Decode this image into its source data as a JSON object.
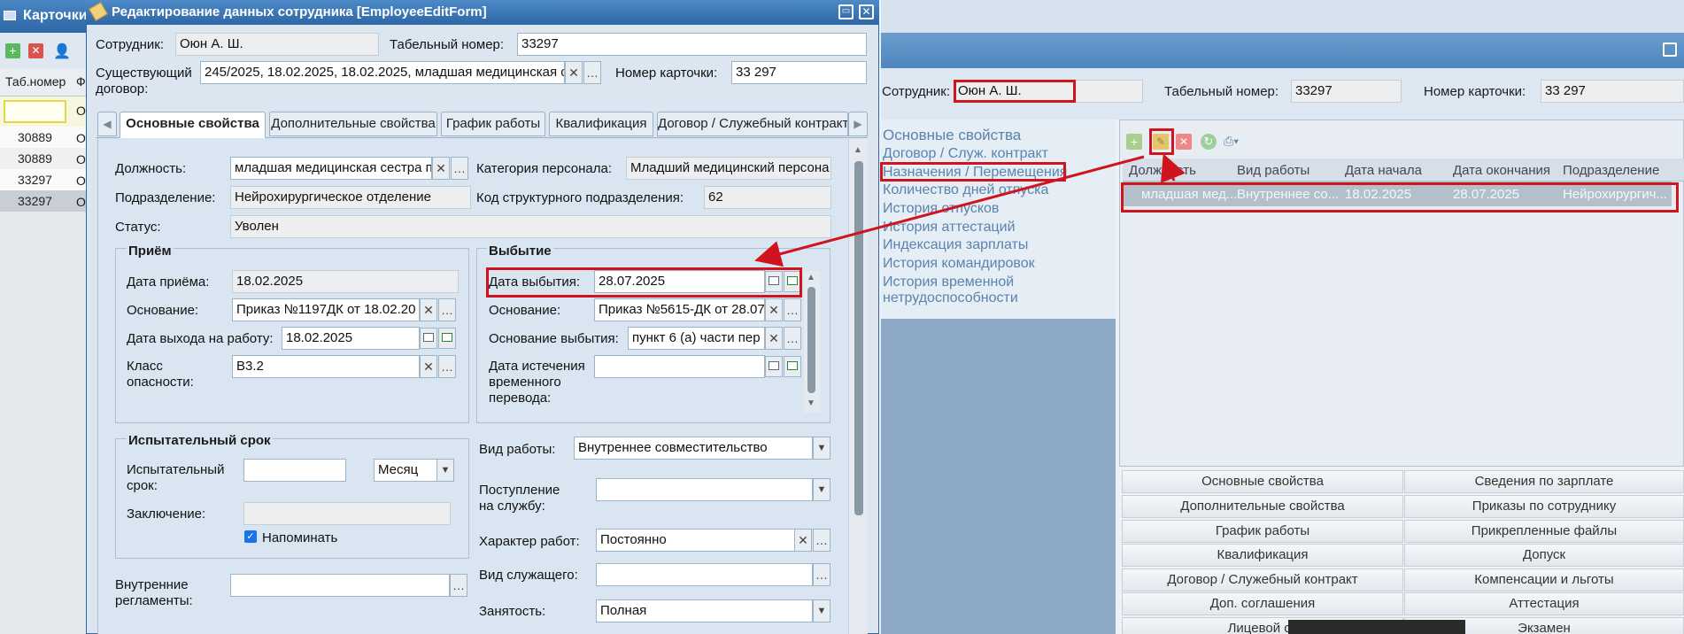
{
  "bg_window": {
    "title": "Карточки",
    "col_tab": "Таб.номер",
    "col_f": "Ф",
    "filter_value": "О",
    "rows": [
      "30889",
      "30889",
      "33297",
      "33297"
    ],
    "row_tail": "О"
  },
  "right_panel": {
    "employee_label": "Сотрудник:",
    "employee_value": "Оюн А. Ш.",
    "tab_label": "Табельный номер:",
    "tab_value": "33297",
    "card_label": "Номер карточки:",
    "card_value": "33 297",
    "nav": [
      "Основные свойства",
      "Договор / Служ. контракт",
      "Назначения / Перемещения",
      "Количество дней отпуска",
      "История отпусков",
      "История аттестаций",
      "Индексация зарплаты",
      "История командировок",
      "История временной нетрудоспособности"
    ],
    "grid_headers": [
      "Должность",
      "Вид работы",
      "Дата начала",
      "Дата окончания",
      "Подразделение"
    ],
    "grid_row": [
      "младшая мед...",
      "Внутреннее со...",
      "18.02.2025",
      "28.07.2025",
      "Нейрохирургич..."
    ],
    "bottom_left": [
      "Основные свойства",
      "Дополнительные свойства",
      "График работы",
      "Квалификация",
      "Договор / Служебный контракт",
      "Доп. соглашения",
      "Лицевой сч"
    ],
    "bottom_right": [
      "Сведения по зарплате",
      "Приказы по сотруднику",
      "Прикрепленные файлы",
      "Допуск",
      "Компенсации и льготы",
      "Аттестация",
      "Экзамен"
    ]
  },
  "dialog": {
    "title": "Редактирование данных сотрудника [EmployeeEditForm]",
    "employee_label": "Сотрудник:",
    "employee_value": "Оюн А. Ш.",
    "tab_number_label": "Табельный номер:",
    "tab_number_value": "33297",
    "contract_label": "Существующий договор:",
    "contract_value": "245/2025, 18.02.2025, 18.02.2025, младшая медицинская с",
    "card_label": "Номер карточки:",
    "card_value": "33 297",
    "tabs": [
      "Основные свойства",
      "Дополнительные свойства",
      "График работы",
      "Квалификация",
      "Договор / Служебный контракт"
    ],
    "position_label": "Должность:",
    "position_value": "младшая медицинская сестра п",
    "category_label": "Категория персонала:",
    "category_value": "Младший медицинский персона",
    "dept_label": "Подразделение:",
    "dept_value": "Нейрохирургическое отделение",
    "dept_code_label": "Код структурного подразделения:",
    "dept_code_value": "62",
    "status_label": "Статус:",
    "status_value": "Уволен",
    "hire": {
      "title": "Приём",
      "date_label": "Дата приёма:",
      "date_value": "18.02.2025",
      "basis_label": "Основание:",
      "basis_value": "Приказ №1197ДК от 18.02.20",
      "start_label": "Дата выхода на работу:",
      "start_value": "18.02.2025",
      "hazard_label": "Класс опасности:",
      "hazard_value": "В3.2"
    },
    "leave": {
      "title": "Выбытие",
      "date_label": "Дата выбытия:",
      "date_value": "28.07.2025",
      "basis_label": "Основание:",
      "basis_value": "Приказ №5615-ДК от 28.07",
      "reason_label": "Основание выбытия:",
      "reason_value": "пункт 6 (а) части пер",
      "temp_label": "Дата истечения временного перевода:"
    },
    "probation": {
      "title": "Испытательный срок",
      "period_label": "Испытательный срок:",
      "unit_value": "Месяц",
      "conclusion_label": "Заключение:",
      "remind_label": "Напоминать"
    },
    "work_type_label": "Вид работы:",
    "work_type_value": "Внутреннее совместительство",
    "service_label": "Поступление на службу:",
    "nature_label": "Характер работ:",
    "nature_value": "Постоянно",
    "employee_kind_label": "Вид служащего:",
    "employment_label": "Занятость:",
    "employment_value": "Полная",
    "internal_label": "Внутренние регламенты:"
  },
  "colors": {
    "highlight": "#d0141e",
    "titlebar": "#3d78b5",
    "panel": "#d9e6f2"
  }
}
